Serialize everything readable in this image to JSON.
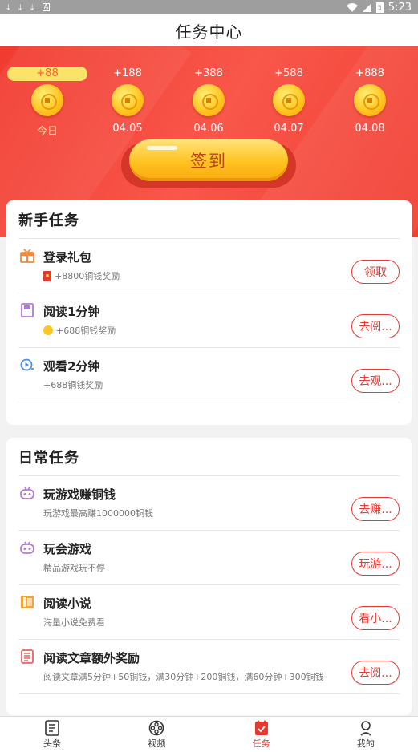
{
  "status_bar": {
    "time": "5:23",
    "battery": "5"
  },
  "title": "任务中心",
  "checkin": {
    "days": [
      {
        "amount": "+88",
        "label": "今日",
        "active": true
      },
      {
        "amount": "+188",
        "label": "04.05"
      },
      {
        "amount": "+388",
        "label": "04.06"
      },
      {
        "amount": "+588",
        "label": "04.07"
      },
      {
        "amount": "+888",
        "label": "04.08"
      }
    ],
    "button": "签到"
  },
  "newbie": {
    "title": "新手任务",
    "tasks": [
      {
        "name": "登录礼包",
        "desc": "+8800铜钱奖励",
        "button": "领取",
        "icon": "gift-icon"
      },
      {
        "name": "阅读1分钟",
        "desc": "+688铜钱奖励",
        "button": "去阅...",
        "icon": "book-icon"
      },
      {
        "name": "观看2分钟",
        "desc": "+688铜钱奖励",
        "button": "去观...",
        "icon": "video-icon"
      }
    ]
  },
  "daily": {
    "title": "日常任务",
    "tasks": [
      {
        "name": "玩游戏赚铜钱",
        "desc": "玩游戏最高赚1000000铜钱",
        "button": "去赚...",
        "icon": "gamepad-icon"
      },
      {
        "name": "玩会游戏",
        "desc": "精品游戏玩不停",
        "button": "玩游...",
        "icon": "gamepad-icon"
      },
      {
        "name": "阅读小说",
        "desc": "海量小说免费看",
        "button": "看小...",
        "icon": "novel-icon"
      },
      {
        "name": "阅读文章额外奖励",
        "desc": "阅读文章满5分钟+50铜钱，满30分钟+200铜钱，满60分钟+300铜钱",
        "button": "去阅...",
        "icon": "article-icon"
      }
    ]
  },
  "nav": [
    {
      "label": "头条",
      "icon": "news-icon"
    },
    {
      "label": "视频",
      "icon": "film-reel-icon"
    },
    {
      "label": "任务",
      "icon": "task-icon",
      "active": true
    },
    {
      "label": "我的",
      "icon": "profile-icon"
    }
  ],
  "colors": {
    "primary_red": "#e53a30",
    "header_red": "#f23a2f",
    "gold": "#ffc21e"
  }
}
